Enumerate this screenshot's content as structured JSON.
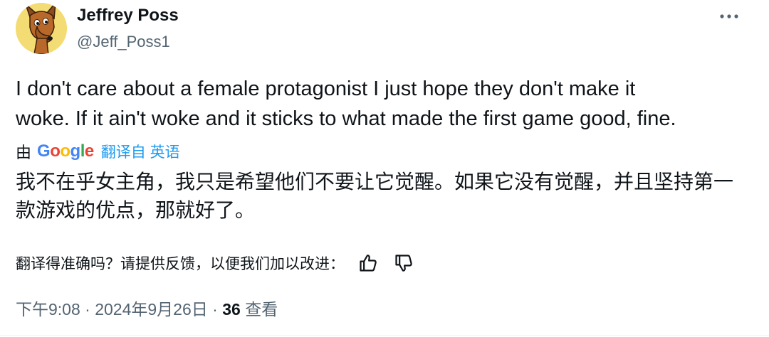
{
  "author": {
    "name": "Jeffrey Poss",
    "handle": "@Jeff_Poss1",
    "avatar_icon": "cartoon-dog-avatar"
  },
  "more_icon": "more-horizontal-icon",
  "tweet": {
    "line1": "I don't care about a female protagonist I just hope they don't make it",
    "line2": "woke. If it ain't woke and it sticks to what made the first game good, fine."
  },
  "translation": {
    "by_label": "由",
    "google_logo": "Google",
    "link_label": "翻译自 英语",
    "text": "我不在乎女主角，我只是希望他们不要让它觉醒。如果它没有觉醒，并且坚持第一款游戏的优点，那就好了。"
  },
  "feedback": {
    "question": "翻译得准确吗？请提供反馈，以便我们加以改进：",
    "thumbs_up_icon": "thumbs-up-icon",
    "thumbs_down_icon": "thumbs-down-icon"
  },
  "meta": {
    "time": "下午9:08",
    "date": "2024年9月26日",
    "separator": "·",
    "views_count": "36",
    "views_label": "查看"
  },
  "colors": {
    "text": "#0f1419",
    "secondary": "#536471",
    "link": "#1d9bf0",
    "google_blue": "#4285f4",
    "google_red": "#ea4335",
    "google_yellow": "#fbbc05",
    "google_green": "#34a853"
  }
}
